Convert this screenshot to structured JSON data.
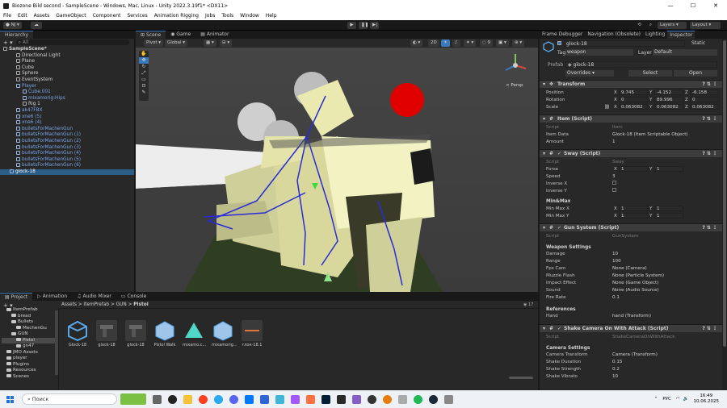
{
  "window": {
    "title": "Biozone Bild second - SampleScene - Windows, Mac, Linux - Unity 2022.3.19f1* <DX11>"
  },
  "menu": [
    "File",
    "Edit",
    "Assets",
    "GameObject",
    "Component",
    "Services",
    "Animation Rigging",
    "Jobs",
    "Tools",
    "Window",
    "Help"
  ],
  "toolbar": {
    "account": "NJ",
    "layers": "Layers",
    "layout": "Layout"
  },
  "hierarchy": {
    "tab": "Hierarchy",
    "search_placeholder": "All",
    "items": [
      {
        "label": "SampleScene*",
        "indent": 0,
        "style": "scene"
      },
      {
        "label": "Directional Light",
        "indent": 2,
        "style": "normal"
      },
      {
        "label": "Plane",
        "indent": 2,
        "style": "normal"
      },
      {
        "label": "Cube",
        "indent": 2,
        "style": "normal"
      },
      {
        "label": "Sphere",
        "indent": 2,
        "style": "normal"
      },
      {
        "label": "EventSystem",
        "indent": 2,
        "style": "normal"
      },
      {
        "label": "Player",
        "indent": 2,
        "style": "blue"
      },
      {
        "label": "Cube.001",
        "indent": 3,
        "style": "blue"
      },
      {
        "label": "mixamorig:Hips",
        "indent": 3,
        "style": "blue"
      },
      {
        "label": "Rig 1",
        "indent": 3,
        "style": "normal"
      },
      {
        "label": "ak47FBX",
        "indent": 2,
        "style": "blue"
      },
      {
        "label": "xne6 (5)",
        "indent": 2,
        "style": "blue"
      },
      {
        "label": "xne6 (4)",
        "indent": 2,
        "style": "blue"
      },
      {
        "label": "bulletsForMachenGun",
        "indent": 2,
        "style": "blue"
      },
      {
        "label": "bulletsForMachenGun (1)",
        "indent": 2,
        "style": "blue"
      },
      {
        "label": "bulletsForMachenGun (2)",
        "indent": 2,
        "style": "blue"
      },
      {
        "label": "bulletsForMachenGun (3)",
        "indent": 2,
        "style": "blue"
      },
      {
        "label": "bulletsForMachenGun (4)",
        "indent": 2,
        "style": "blue"
      },
      {
        "label": "bulletsForMachenGun (5)",
        "indent": 2,
        "style": "blue"
      },
      {
        "label": "bulletsForMachenGun (6)",
        "indent": 2,
        "style": "blue"
      },
      {
        "label": "glock-18",
        "indent": 1,
        "style": "selected"
      }
    ]
  },
  "scene": {
    "tabs": [
      "Scene",
      "Game",
      "Animator"
    ],
    "pivot": "Pivot",
    "global": "Global",
    "persp": "< Persp",
    "mode_2d": "2D"
  },
  "project": {
    "tabs": [
      "Project",
      "Animation",
      "Audio Mixer",
      "Console"
    ],
    "breadcrumb": [
      "Assets",
      "ItemPrefab",
      "GUN",
      "Pistol"
    ],
    "count": "17",
    "tree": [
      {
        "label": "ItemPrefab",
        "indent": 1
      },
      {
        "label": "bread",
        "indent": 2
      },
      {
        "label": "Bullets",
        "indent": 2
      },
      {
        "label": "MechenGu",
        "indent": 3
      },
      {
        "label": "GUN",
        "indent": 2
      },
      {
        "label": "Pistol",
        "indent": 3
      },
      {
        "label": "gn47",
        "indent": 3
      },
      {
        "label": "JMO Assets",
        "indent": 1
      },
      {
        "label": "player",
        "indent": 1
      },
      {
        "label": "Plugins",
        "indent": 1
      },
      {
        "label": "Resources",
        "indent": 1
      },
      {
        "label": "Scenes",
        "indent": 1
      }
    ],
    "assets": [
      "Glock-18",
      "glock-18",
      "glock-18",
      "Pistol Walk",
      "mixamo.c...",
      "mixamorig...",
      "глок-18.1"
    ]
  },
  "right_tabs": [
    "Frame Debugger",
    "Navigation (Obsolete)",
    "Lighting",
    "Inspector"
  ],
  "inspector": {
    "object_name": "glock-18",
    "static": "Static",
    "tag_label": "Tag",
    "tag": "weapon",
    "layer_label": "Layer",
    "layer": "Default",
    "prefab_label": "Prefab",
    "prefab": "glock-18",
    "overrides": "Overrides",
    "select": "Select",
    "open": "Open",
    "transform": {
      "title": "Transform",
      "position_label": "Position",
      "rotation_label": "Rotation",
      "scale_label": "Scale",
      "position": [
        "9.745",
        "-4.152",
        "-6.158"
      ],
      "rotation": [
        "0",
        "89.996",
        "0"
      ],
      "scale": [
        "0.063082",
        "0.063082",
        "0.063082"
      ]
    },
    "item": {
      "title": "Item (Script)",
      "script_label": "Script",
      "script": "Item",
      "data_label": "Item Data",
      "data": "Glock-18 (Item Scriptable Object)",
      "amount_label": "Amount",
      "amount": "1"
    },
    "sway": {
      "title": "Sway (Script)",
      "script_label": "Script",
      "script": "Sway",
      "forse_label": "Forse",
      "forse": [
        "1",
        "1"
      ],
      "speed_label": "Speed",
      "speed": "3",
      "inverse_x": "Inverse X",
      "inverse_y": "Inverse Y",
      "minmax_label": "Min&Max",
      "minmax_x_label": "Min Max X",
      "minmax_x": [
        "1",
        "1"
      ],
      "minmax_y_label": "Min Max Y",
      "minmax_y": [
        "1",
        "1"
      ]
    },
    "gun": {
      "title": "Gun System (Script)",
      "script_label": "Script",
      "script": "GunSystem",
      "weapon_settings": "Weapon Settings",
      "damage_label": "Damage",
      "damage": "10",
      "range_label": "Range",
      "range": "100",
      "fps_cam_label": "Fps Cam",
      "fps_cam": "None (Camera)",
      "muzzle_label": "Muzzle Flash",
      "muzzle": "None (Particle System)",
      "impact_label": "Impact Effect",
      "impact": "None (Game Object)",
      "sound_label": "Sound",
      "sound": "None (Audio Source)",
      "fire_rate_label": "Fire Rate",
      "fire_rate": "0.1",
      "references": "References",
      "hand_label": "Hand",
      "hand": "hand (Transform)"
    },
    "shake": {
      "title": "Shake Camera On With Attack (Script)",
      "script_label": "Script",
      "script": "ShakeCameraOnWithAttack",
      "camera_settings": "Camera Settings",
      "cam_transform_label": "Camera Transform",
      "cam_transform": "Camera (Transform)",
      "duration_label": "Shake Duration",
      "duration": "0.15",
      "strength_label": "Shake Strength",
      "strength": "0.2",
      "vibrato_label": "Shake Vibrato",
      "vibrato": "10"
    }
  },
  "taskbar": {
    "search": "Поиск",
    "lang": "РУС",
    "time": "16:49",
    "date": "10.06.2025"
  },
  "colors": {
    "accent": "#3a79bb",
    "selection": "#2c5d87",
    "prefab_blue": "#7ba5e6"
  }
}
